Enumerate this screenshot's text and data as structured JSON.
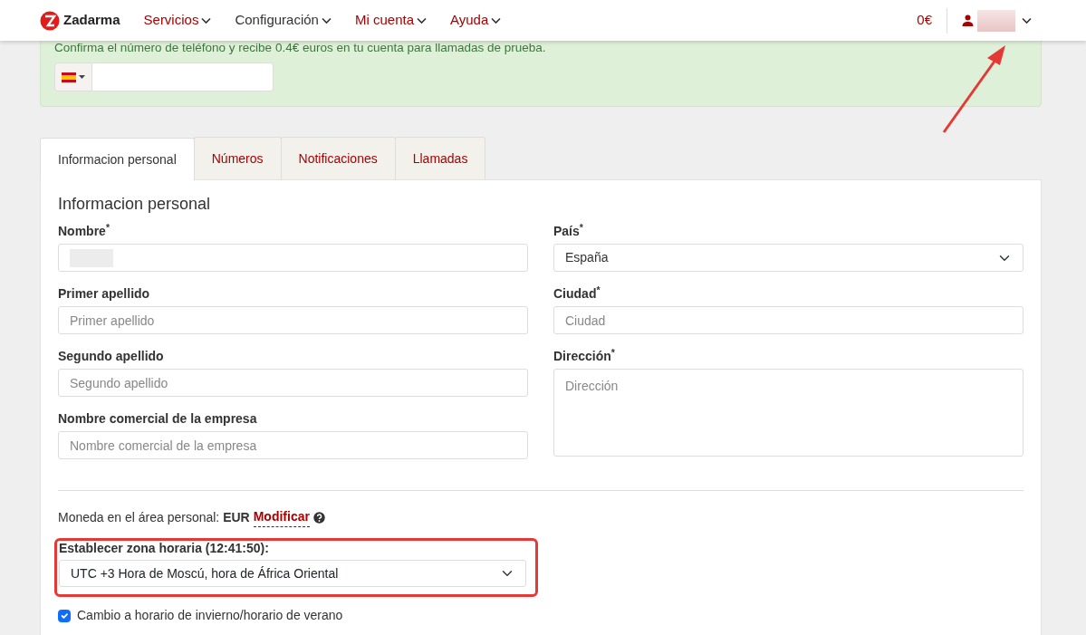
{
  "navbar": {
    "brand": "Zadarma",
    "menu": [
      {
        "label": "Servicios",
        "selected": false
      },
      {
        "label": "Configuración",
        "selected": true
      },
      {
        "label": "Mi cuenta",
        "selected": false
      },
      {
        "label": "Ayuda",
        "selected": false
      }
    ],
    "balance": "0€"
  },
  "banner": {
    "text": "Confirma el número de teléfono y recibe 0.4€ euros en tu cuenta para llamadas de prueba."
  },
  "tabs": [
    {
      "label": "Informacion personal",
      "selected": true
    },
    {
      "label": "Números",
      "selected": false
    },
    {
      "label": "Notificaciones",
      "selected": false
    },
    {
      "label": "Llamadas",
      "selected": false
    }
  ],
  "section_title": "Informacion personal",
  "left_fields": [
    {
      "label": "Nombre",
      "mark": "*",
      "kind": "blurred"
    },
    {
      "label": "Primer apellido",
      "kind": "input",
      "placeholder": "Primer apellido"
    },
    {
      "label": "Segundo apellido",
      "kind": "input",
      "placeholder": "Segundo apellido"
    },
    {
      "label": "Nombre comercial de la empresa",
      "kind": "input",
      "placeholder": "Nombre comercial de la empresa"
    }
  ],
  "right_fields": [
    {
      "label": "País",
      "mark": "*",
      "kind": "select",
      "value": "España"
    },
    {
      "label": "Ciudad",
      "mark": "*",
      "kind": "input",
      "placeholder": "Ciudad"
    },
    {
      "label": "Dirección",
      "mark": "*",
      "kind": "textarea",
      "placeholder": "Dirección"
    }
  ],
  "currency": {
    "text": "Moneda en el área personal: **EUR**",
    "link": "Modificar"
  },
  "timezone": {
    "label": "Establecer zona horaria (12:41:50):",
    "value": "UTC +3 Hora de Moscú, hora de África Oriental"
  },
  "dst": {
    "label": "Cambio a horario de invierno/horario de verano",
    "checked": true
  }
}
